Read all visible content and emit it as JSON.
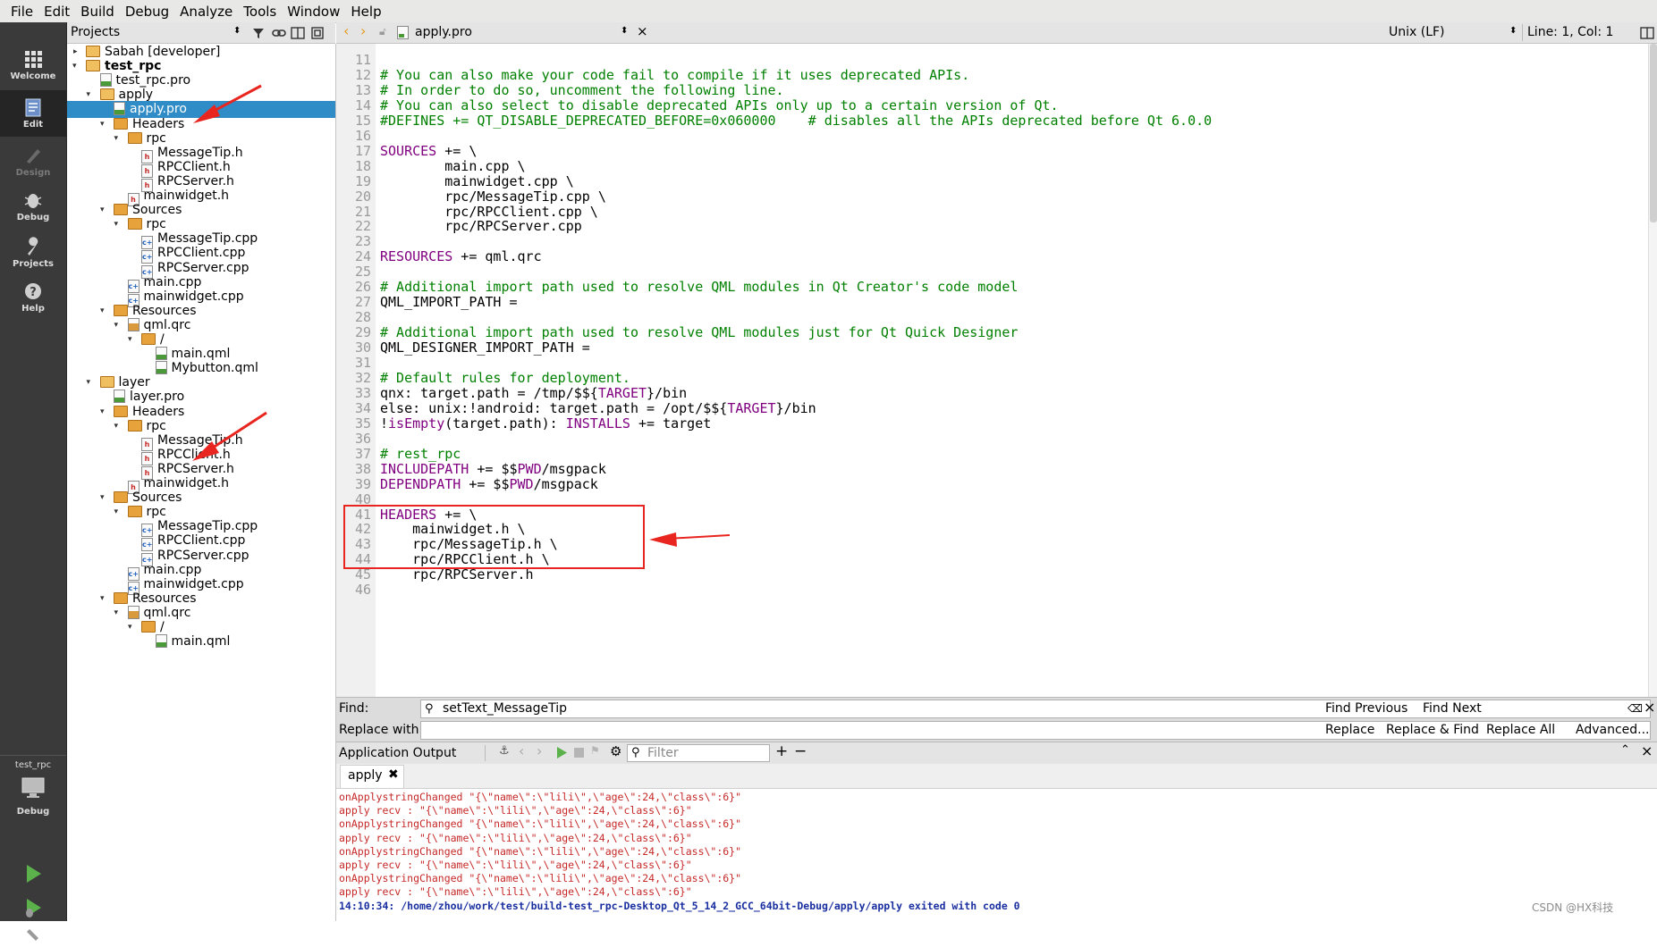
{
  "menu": [
    "File",
    "Edit",
    "Build",
    "Debug",
    "Analyze",
    "Tools",
    "Window",
    "Help"
  ],
  "modes": {
    "welcome": "Welcome",
    "edit": "Edit",
    "design": "Design",
    "debug": "Debug",
    "projects": "Projects",
    "help": "Help",
    "target_name": "test_rpc",
    "target_mode": "Debug"
  },
  "projects_pane": {
    "title": "Projects",
    "tree": [
      {
        "label": "Sabah [developer]",
        "kind": "project"
      },
      {
        "label": "test_rpc",
        "kind": "project",
        "bold": true
      },
      {
        "label": "test_rpc.pro",
        "kind": "pro"
      },
      {
        "label": "apply",
        "kind": "project"
      },
      {
        "label": "apply.pro",
        "kind": "pro",
        "selected": true
      },
      {
        "label": "Headers",
        "kind": "folder"
      },
      {
        "label": "rpc",
        "kind": "folder"
      },
      {
        "label": "MessageTip.h",
        "kind": "h"
      },
      {
        "label": "RPCClient.h",
        "kind": "h"
      },
      {
        "label": "RPCServer.h",
        "kind": "h"
      },
      {
        "label": "mainwidget.h",
        "kind": "h"
      },
      {
        "label": "Sources",
        "kind": "folder"
      },
      {
        "label": "rpc",
        "kind": "folder"
      },
      {
        "label": "MessageTip.cpp",
        "kind": "cpp"
      },
      {
        "label": "RPCClient.cpp",
        "kind": "cpp"
      },
      {
        "label": "RPCServer.cpp",
        "kind": "cpp"
      },
      {
        "label": "main.cpp",
        "kind": "cpp"
      },
      {
        "label": "mainwidget.cpp",
        "kind": "cpp"
      },
      {
        "label": "Resources",
        "kind": "folder"
      },
      {
        "label": "qml.qrc",
        "kind": "qrc"
      },
      {
        "label": "/",
        "kind": "folder"
      },
      {
        "label": "main.qml",
        "kind": "qml"
      },
      {
        "label": "Mybutton.qml",
        "kind": "qml"
      },
      {
        "label": "layer",
        "kind": "project"
      },
      {
        "label": "layer.pro",
        "kind": "pro"
      },
      {
        "label": "Headers",
        "kind": "folder"
      },
      {
        "label": "rpc",
        "kind": "folder"
      },
      {
        "label": "MessageTip.h",
        "kind": "h"
      },
      {
        "label": "RPCClient.h",
        "kind": "h"
      },
      {
        "label": "RPCServer.h",
        "kind": "h"
      },
      {
        "label": "mainwidget.h",
        "kind": "h"
      },
      {
        "label": "Sources",
        "kind": "folder"
      },
      {
        "label": "rpc",
        "kind": "folder"
      },
      {
        "label": "MessageTip.cpp",
        "kind": "cpp"
      },
      {
        "label": "RPCClient.cpp",
        "kind": "cpp"
      },
      {
        "label": "RPCServer.cpp",
        "kind": "cpp"
      },
      {
        "label": "main.cpp",
        "kind": "cpp"
      },
      {
        "label": "mainwidget.cpp",
        "kind": "cpp"
      },
      {
        "label": "Resources",
        "kind": "folder"
      },
      {
        "label": "qml.qrc",
        "kind": "qrc"
      },
      {
        "label": "/",
        "kind": "folder"
      },
      {
        "label": "main.qml",
        "kind": "qml"
      }
    ]
  },
  "editor": {
    "file_tab": "apply.pro",
    "line_ending": "Unix (LF)",
    "cursor": "Line: 1, Col: 1",
    "lines": [
      {
        "n": "11",
        "t": ""
      },
      {
        "n": "12",
        "t": "# You can also make your code fail to compile if it uses deprecated APIs.",
        "c": "cm"
      },
      {
        "n": "13",
        "t": "# In order to do so, uncomment the following line.",
        "c": "cm"
      },
      {
        "n": "14",
        "t": "# You can also select to disable deprecated APIs only up to a certain version of Qt.",
        "c": "cm"
      },
      {
        "n": "15",
        "t": "#DEFINES += QT_DISABLE_DEPRECATED_BEFORE=0x060000    # disables all the APIs deprecated before Qt 6.0.0",
        "c": "cm"
      },
      {
        "n": "16",
        "t": ""
      },
      {
        "n": "17",
        "t": "SOURCES += \\",
        "k": "SOURCES"
      },
      {
        "n": "18",
        "t": "        main.cpp \\"
      },
      {
        "n": "19",
        "t": "        mainwidget.cpp \\"
      },
      {
        "n": "20",
        "t": "        rpc/MessageTip.cpp \\"
      },
      {
        "n": "21",
        "t": "        rpc/RPCClient.cpp \\"
      },
      {
        "n": "22",
        "t": "        rpc/RPCServer.cpp"
      },
      {
        "n": "23",
        "t": ""
      },
      {
        "n": "24",
        "t": "RESOURCES += qml.qrc",
        "k": "RESOURCES"
      },
      {
        "n": "25",
        "t": ""
      },
      {
        "n": "26",
        "t": "# Additional import path used to resolve QML modules in Qt Creator's code model",
        "c": "cm"
      },
      {
        "n": "27",
        "t": "QML_IMPORT_PATH ="
      },
      {
        "n": "28",
        "t": ""
      },
      {
        "n": "29",
        "t": "# Additional import path used to resolve QML modules just for Qt Quick Designer",
        "c": "cm"
      },
      {
        "n": "30",
        "t": "QML_DESIGNER_IMPORT_PATH ="
      },
      {
        "n": "31",
        "t": ""
      },
      {
        "n": "32",
        "t": "# Default rules for deployment.",
        "c": "cm"
      },
      {
        "n": "33",
        "t": "qnx: target.path = /tmp/$${TARGET}/bin",
        "k2": "TARGET"
      },
      {
        "n": "34",
        "t": "else: unix:!android: target.path = /opt/$${TARGET}/bin",
        "k2": "TARGET"
      },
      {
        "n": "35",
        "t": "!isEmpty(target.path): INSTALLS += target",
        "k3": true
      },
      {
        "n": "36",
        "t": ""
      },
      {
        "n": "37",
        "t": "# rest_rpc",
        "c": "cm"
      },
      {
        "n": "38",
        "t": "INCLUDEPATH += $$PWD/msgpack",
        "k": "INCLUDEPATH",
        "k2": "PWD"
      },
      {
        "n": "39",
        "t": "DEPENDPATH += $$PWD/msgpack",
        "k": "DEPENDPATH",
        "k2": "PWD"
      },
      {
        "n": "40",
        "t": ""
      },
      {
        "n": "41",
        "t": "HEADERS += \\",
        "k": "HEADERS"
      },
      {
        "n": "42",
        "t": "    mainwidget.h \\"
      },
      {
        "n": "43",
        "t": "    rpc/MessageTip.h \\"
      },
      {
        "n": "44",
        "t": "    rpc/RPCClient.h \\"
      },
      {
        "n": "45",
        "t": "    rpc/RPCServer.h"
      },
      {
        "n": "46",
        "t": ""
      }
    ]
  },
  "find": {
    "find_label": "Find:",
    "find_value": "setText_MessageTip",
    "replace_label": "Replace with:",
    "replace_value": "",
    "find_previous": "Find Previous",
    "find_next": "Find Next",
    "replace": "Replace",
    "replace_find": "Replace & Find",
    "replace_all": "Replace All",
    "advanced": "Advanced..."
  },
  "output": {
    "title": "Application Output",
    "filter_placeholder": "Filter",
    "tab": "apply",
    "lines": [
      "onApplystringChanged \"{\\\"name\\\":\\\"lili\\\",\\\"age\\\":24,\\\"class\\\":6}\"",
      "apply recv : \"{\\\"name\\\":\\\"lili\\\",\\\"age\\\":24,\\\"class\\\":6}\"",
      "onApplystringChanged \"{\\\"name\\\":\\\"lili\\\",\\\"age\\\":24,\\\"class\\\":6}\"",
      "apply recv : \"{\\\"name\\\":\\\"lili\\\",\\\"age\\\":24,\\\"class\\\":6}\"",
      "onApplystringChanged \"{\\\"name\\\":\\\"lili\\\",\\\"age\\\":24,\\\"class\\\":6}\"",
      "apply recv : \"{\\\"name\\\":\\\"lili\\\",\\\"age\\\":24,\\\"class\\\":6}\"",
      "onApplystringChanged \"{\\\"name\\\":\\\"lili\\\",\\\"age\\\":24,\\\"class\\\":6}\"",
      "apply recv : \"{\\\"name\\\":\\\"lili\\\",\\\"age\\\":24,\\\"class\\\":6}\""
    ],
    "exit_line": "14:10:34: /home/zhou/work/test/build-test_rpc-Desktop_Qt_5_14_2_GCC_64bit-Debug/apply/apply exited with code 0"
  },
  "watermark": "CSDN @HX科技",
  "colors": {
    "selection": "#308cc6",
    "annotation": "#e8251f",
    "comment": "#008000",
    "keyword": "#800080"
  }
}
